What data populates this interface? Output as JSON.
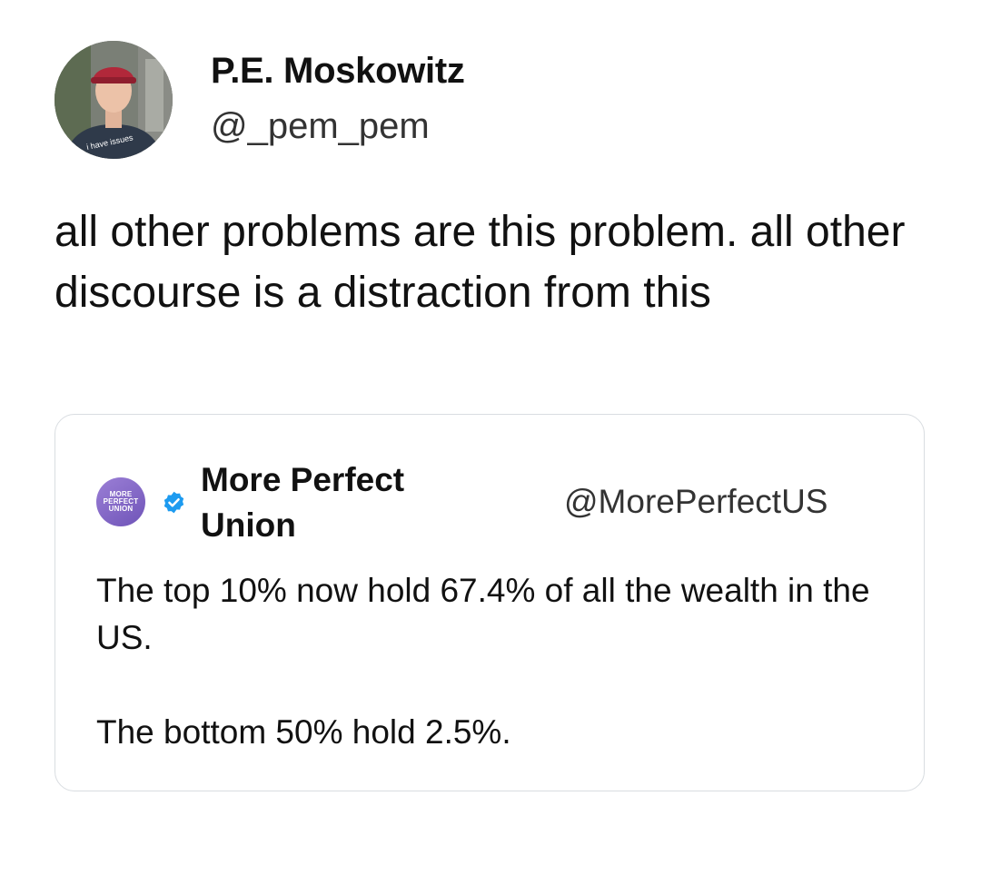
{
  "tweet": {
    "author": {
      "name": "P.E. Moskowitz",
      "handle": "@_pem_pem",
      "avatar_icon": "profile-photo-icon",
      "shirt_text": "i have issues"
    },
    "text": "all other problems are this problem. all other discourse is a distraction from this"
  },
  "quoted_tweet": {
    "author": {
      "name": "More Perfect Union",
      "handle": "@MorePerfectUS",
      "avatar_logo_lines": [
        "MORE",
        "PERFECT",
        "UNION"
      ],
      "verified": true
    },
    "paragraphs": [
      "The top 10% now hold 67.4% of all the wealth in the US.",
      "The bottom 50% hold 2.5%."
    ]
  },
  "colors": {
    "text": "#111111",
    "handle": "#333333",
    "card_border": "#d9dde1",
    "verified_blue": "#1d9bf0",
    "logo_purple": "#7e62c6"
  }
}
